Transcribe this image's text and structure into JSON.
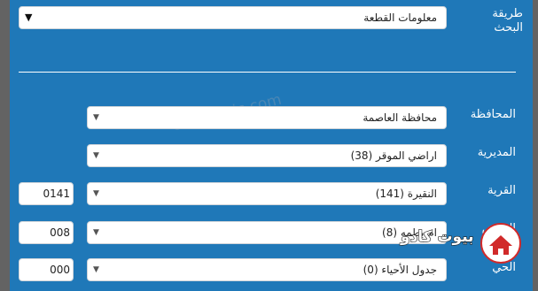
{
  "search_method": {
    "label": "طريقة البحث",
    "value": "معلومات القطعة"
  },
  "watermark": "© www.        ic.com",
  "fields": {
    "governorate": {
      "label": "المحافظة",
      "value": "محافظة العاصمة"
    },
    "directorate": {
      "label": "المديرية",
      "value": "اراضي الموقر (38)"
    },
    "village": {
      "label": "القرية",
      "value": "النقيرة (141)",
      "code": "0141"
    },
    "basin": {
      "label": "الحوض",
      "value": "ام بطمه (8)",
      "code": "008"
    },
    "neighborhood": {
      "label": "الحي",
      "value": "جدول الأحياء (0)",
      "code": "000"
    }
  },
  "logo": {
    "text": "بيوت كادو",
    "badge_color": "#d12a2a"
  },
  "colors": {
    "panel": "#1f78b8",
    "edge": "#636363"
  }
}
